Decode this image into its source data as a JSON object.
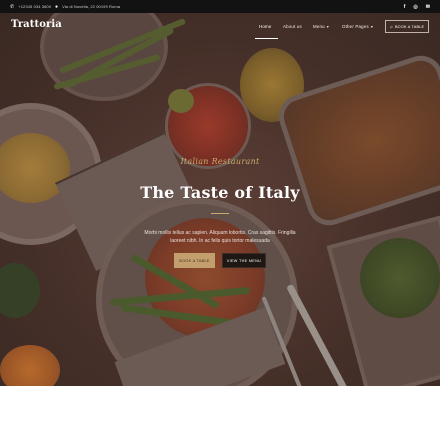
{
  "topbar": {
    "phone": "+12345 034 3600",
    "address": "Via di Novella, 22 00199 Roma",
    "social": [
      "f",
      "◎",
      "✉"
    ]
  },
  "header": {
    "logo": "Trattoria",
    "nav": {
      "home": "Home",
      "about": "About us",
      "menu": "Menu",
      "other": "Other Pages"
    },
    "book_button": "BOOK A TABLE"
  },
  "hero": {
    "subtitle": "Italian Restaurant",
    "title": "The Taste of Italy",
    "description": "Morbi mollis tellus ac sapien. Aliquam lobortis. Cras sagittis. Fringilla laoreet nibh. In ac felis quis tortor malesuada",
    "primary_button": "BOOK A TABLE",
    "secondary_button": "VIEW THE MENU"
  },
  "icons": {
    "phone": "phone-icon",
    "location": "location-pin-icon",
    "bell": "bell-icon"
  },
  "colors": {
    "topbar": "#121212",
    "accent_gold": "#c39f6d",
    "hero_overlay": "#463029"
  }
}
